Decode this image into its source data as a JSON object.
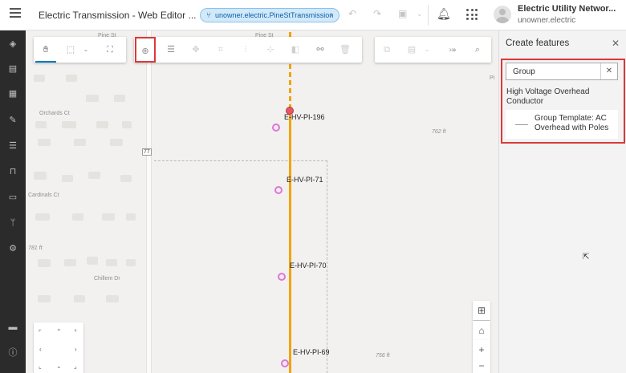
{
  "header": {
    "app_title": "Electric Transmission - Web Editor ...",
    "version_name": "unowner.electric.PineStTransmission",
    "user_name": "Electric Utility Networ...",
    "user_sub": "unowner.electric"
  },
  "map": {
    "roads": {
      "pine_st_left": "Pine St",
      "pine_st_right": "Pine St",
      "orchards_ct": "Orchards Ct",
      "cardinals_ct": "Cardinals Ct",
      "chillem_dr": "Chillem Dr",
      "route_77": "77",
      "pi": "Pi"
    },
    "elevations": {
      "e762": "762 ft",
      "e781": "781 ft",
      "e756": "756 ft"
    },
    "poles": {
      "p196": "E-HV-PI-196",
      "p71": "E-HV-PI-71",
      "p70": "E-HV-PI-70",
      "p69": "E-HV-PI-69"
    }
  },
  "panel": {
    "title": "Create features",
    "search_value": "Group",
    "group_title": "High Voltage Overhead Conductor",
    "template_label": "Group Template: AC Overhead with Poles"
  },
  "colors": {
    "accent": "#007ac2",
    "highlight": "#d93a3a",
    "conductor": "#f0a30a",
    "pole": "#d77bd1"
  },
  "icons": {
    "menu": "hamburger-icon",
    "version": "branch-icon",
    "notifications": "bell-icon",
    "app_launcher": "grid-icon"
  }
}
